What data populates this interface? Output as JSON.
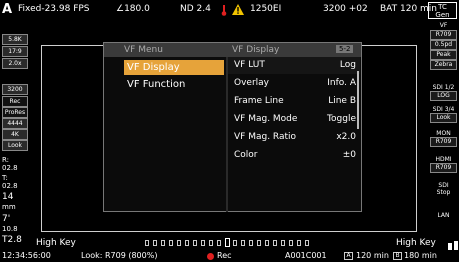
{
  "top": {
    "mode": "A",
    "fps": "Fixed-23.98 FPS",
    "shutter": "∠180.0",
    "nd": "ND 2.4",
    "ei": "1250EI",
    "wb": "3200 +02",
    "battery": "BAT 120 min",
    "tc_gen": [
      "TC",
      "Gen"
    ]
  },
  "left": {
    "res": "5.8K",
    "ratio": "17:9",
    "squeeze": "2.0x",
    "kelvin": "3200",
    "rec": "Rec",
    "codec": "ProRes",
    "codec_num": "4444",
    "rec_res": "4K",
    "look": "Look",
    "r_label": "R:",
    "r_val": "02.8",
    "t_label": "T:",
    "t_val": "02.8",
    "focal": "14",
    "focal_unit": "mm",
    "dist": "7'",
    "dist2": "10.8",
    "t28": "T2.8"
  },
  "right": {
    "vf": "VF",
    "vf_look": "R709",
    "vf_gain": "0.5pd",
    "peak": "Peak",
    "zebra": "Zebra",
    "sdi12": "SDI 1/2",
    "sdi12_val": "LOG",
    "sdi34": "SDI 3/4",
    "sdi34_val": "Look",
    "mon": "MON",
    "mon_val": "R709",
    "hdmi": "HDMI",
    "hdmi_val": "R709",
    "sdi": "SDI",
    "sdi_val": "Stop",
    "lan": "LAN"
  },
  "menu": {
    "title": "VF Menu",
    "items": [
      {
        "label": "VF Display"
      },
      {
        "label": "VF Function"
      }
    ],
    "submenu_title": "VF Display",
    "page": "5-2",
    "settings": [
      {
        "key": "VF LUT",
        "value": "Log"
      },
      {
        "key": "Overlay",
        "value": "Info. A"
      },
      {
        "key": "Frame Line",
        "value": "Line B"
      },
      {
        "key": "VF Mag. Mode",
        "value": "Toggle"
      },
      {
        "key": "VF Mag. Ratio",
        "value": "x2.0"
      },
      {
        "key": "Color",
        "value": "±0"
      }
    ]
  },
  "bottom": {
    "high_key_left": "High Key",
    "high_key_right": "High Key",
    "timecode": "12:34:56:00",
    "look": "Look: R709 (800%)",
    "rec": "Rec",
    "clip": "A001C001",
    "media_a": "A",
    "media_a_time": "120 min",
    "media_b": "B",
    "media_b_time": "180 min"
  },
  "colors": {
    "menu_highlight": "#e6a33a",
    "rec": "#e02020",
    "warning": "#f2c400",
    "temp_warning": "#e02020"
  }
}
